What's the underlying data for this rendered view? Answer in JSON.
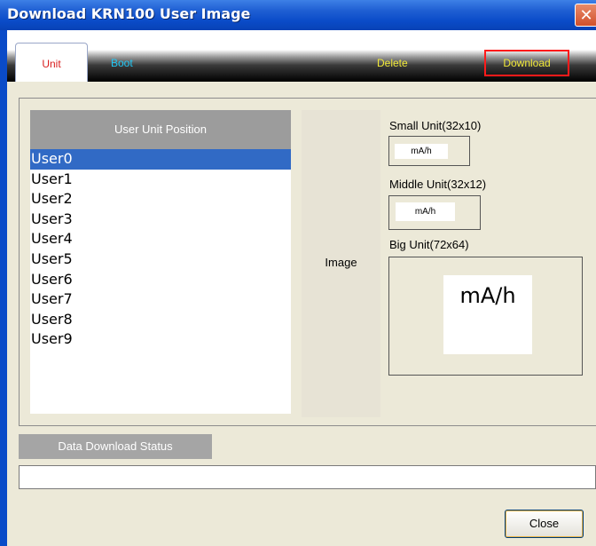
{
  "window": {
    "title": "Download KRN100 User Image",
    "close_glyph": "✕"
  },
  "tabs": {
    "unit": "Unit",
    "boot": "Boot",
    "delete": "Delete",
    "download": "Download"
  },
  "user_list": {
    "header": "User Unit Position",
    "items": [
      "User0",
      "User1",
      "User2",
      "User3",
      "User4",
      "User5",
      "User6",
      "User7",
      "User8",
      "User9"
    ],
    "selected": "User0"
  },
  "image_panel": {
    "label": "Image",
    "small_unit": {
      "label": "Small Unit(32x10)",
      "value": "mA/h"
    },
    "middle_unit": {
      "label": "Middle Unit(32x12)",
      "value": "mA/h"
    },
    "big_unit": {
      "label": "Big Unit(72x64)",
      "value": "mA/h"
    }
  },
  "status": {
    "label": "Data Download Status",
    "progress": 0
  },
  "buttons": {
    "close": "Close"
  },
  "colors": {
    "title_bar": "#0a4bc8",
    "selected_row": "#316ac5",
    "unit_tab_text": "#d81e1e",
    "boot_tab_text": "#21c7f4",
    "delete_download_text": "#f0e838",
    "download_highlight": "#ff1a1a"
  }
}
